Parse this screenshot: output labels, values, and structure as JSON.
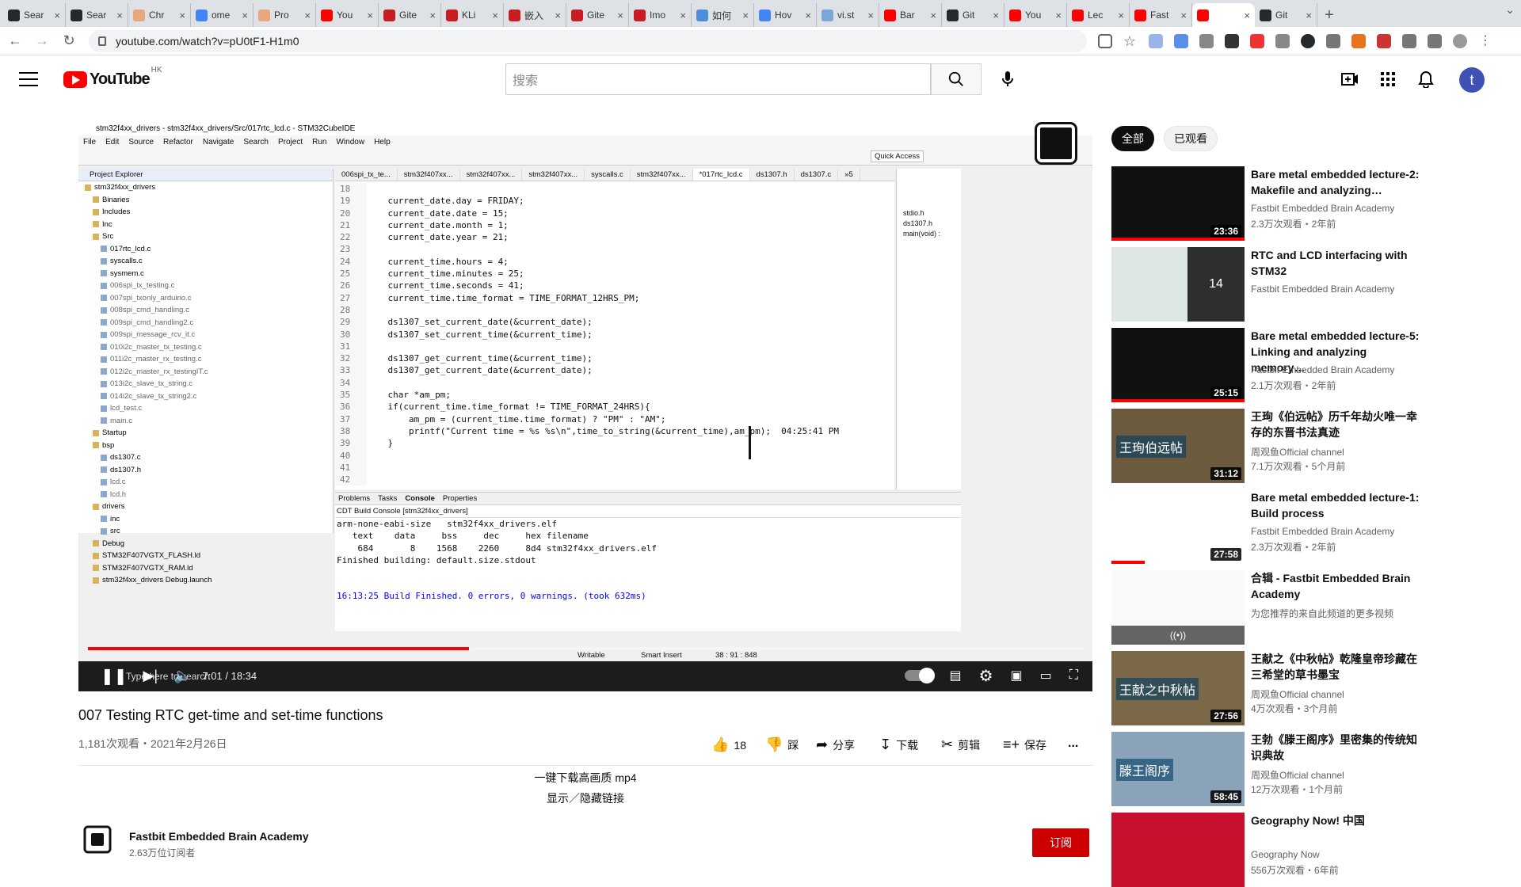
{
  "browser": {
    "tabs": [
      {
        "label": "Sear",
        "color": "#24292e"
      },
      {
        "label": "Sear",
        "color": "#24292e"
      },
      {
        "label": "Chr",
        "color": "#e8a87c"
      },
      {
        "label": "ome",
        "color": "#4285f4"
      },
      {
        "label": "Pro",
        "color": "#e8a87c"
      },
      {
        "label": "You",
        "color": "#ff0000"
      },
      {
        "label": "Gite",
        "color": "#c71d23"
      },
      {
        "label": "KLi",
        "color": "#c71d23"
      },
      {
        "label": "嵌入",
        "color": "#c71d23"
      },
      {
        "label": "Gite",
        "color": "#c71d23"
      },
      {
        "label": "Imo",
        "color": "#c71d23"
      },
      {
        "label": "如何",
        "color": "#4a90d9"
      },
      {
        "label": "Hov",
        "color": "#4285f4"
      },
      {
        "label": "vi.st",
        "color": "#7aa7d8"
      },
      {
        "label": "Bar",
        "color": "#ff0000"
      },
      {
        "label": "Git",
        "color": "#24292e"
      },
      {
        "label": "You",
        "color": "#ff0000"
      },
      {
        "label": "Lec",
        "color": "#ff0000"
      },
      {
        "label": "Fast",
        "color": "#ff0000"
      },
      {
        "label": "",
        "color": "#ff0000",
        "active": true
      },
      {
        "label": "Git",
        "color": "#24292e"
      }
    ],
    "new_tab": "+",
    "url": "youtube.com/watch?v=pU0tF1-H1m0"
  },
  "yt": {
    "logo_text": "YouTube",
    "region": "HK",
    "search_placeholder": "搜索",
    "avatar_letter": "t"
  },
  "video": {
    "ide_title": "stm32f4xx_drivers - stm32f4xx_drivers/Src/017rtc_lcd.c - STM32CubeIDE",
    "menu": [
      "File",
      "Edit",
      "Source",
      "Refactor",
      "Navigate",
      "Search",
      "Project",
      "Run",
      "Window",
      "Help"
    ],
    "quick_access": "Quick Access",
    "project_explorer": "Project Explorer",
    "tree": [
      {
        "t": "stm32f4xx_drivers",
        "i": 0
      },
      {
        "t": "Binaries",
        "i": 1
      },
      {
        "t": "Includes",
        "i": 1
      },
      {
        "t": "Inc",
        "i": 1
      },
      {
        "t": "Src",
        "i": 1
      },
      {
        "t": "017rtc_lcd.c",
        "i": 2
      },
      {
        "t": "syscalls.c",
        "i": 2
      },
      {
        "t": "sysmem.c",
        "i": 2
      },
      {
        "t": "006spi_tx_testing.c",
        "i": 2,
        "d": true
      },
      {
        "t": "007spi_txonly_arduino.c",
        "i": 2,
        "d": true
      },
      {
        "t": "008spi_cmd_handling.c",
        "i": 2,
        "d": true
      },
      {
        "t": "009spi_cmd_handling2.c",
        "i": 2,
        "d": true
      },
      {
        "t": "009spi_message_rcv_it.c",
        "i": 2,
        "d": true
      },
      {
        "t": "010i2c_master_tx_testing.c",
        "i": 2,
        "d": true
      },
      {
        "t": "011i2c_master_rx_testing.c",
        "i": 2,
        "d": true
      },
      {
        "t": "012i2c_master_rx_testingIT.c",
        "i": 2,
        "d": true
      },
      {
        "t": "013i2c_slave_tx_string.c",
        "i": 2,
        "d": true
      },
      {
        "t": "014i2c_slave_tx_string2.c",
        "i": 2,
        "d": true
      },
      {
        "t": "lcd_test.c",
        "i": 2,
        "d": true
      },
      {
        "t": "main.c",
        "i": 2,
        "d": true
      },
      {
        "t": "Startup",
        "i": 1
      },
      {
        "t": "bsp",
        "i": 1
      },
      {
        "t": "ds1307.c",
        "i": 2
      },
      {
        "t": "ds1307.h",
        "i": 2
      },
      {
        "t": "lcd.c",
        "i": 2,
        "d": true
      },
      {
        "t": "lcd.h",
        "i": 2,
        "d": true
      },
      {
        "t": "drivers",
        "i": 1
      },
      {
        "t": "inc",
        "i": 2
      },
      {
        "t": "src",
        "i": 2
      },
      {
        "t": "Debug",
        "i": 1
      },
      {
        "t": "STM32F407VGTX_FLASH.ld",
        "i": 1
      },
      {
        "t": "STM32F407VGTX_RAM.ld",
        "i": 1
      },
      {
        "t": "stm32f4xx_drivers Debug.launch",
        "i": 1
      }
    ],
    "editor_tabs": [
      "006spi_tx_te...",
      "stm32f407xx...",
      "stm32f407xx...",
      "stm32f407xx...",
      "syscalls.c",
      "stm32f407xx...",
      "*017rtc_lcd.c",
      "ds1307.h",
      "ds1307.c",
      "»5"
    ],
    "code": [
      "18|",
      "19|    current_date.day = FRIDAY;",
      "20|    current_date.date = 15;",
      "21|    current_date.month = 1;",
      "22|    current_date.year = 21;",
      "23|",
      "24|    current_time.hours = 4;",
      "25|    current_time.minutes = 25;",
      "26|    current_time.seconds = 41;",
      "27|    current_time.time_format = TIME_FORMAT_12HRS_PM;",
      "28|",
      "29|    ds1307_set_current_date(&current_date);",
      "30|    ds1307_set_current_time(&current_time);",
      "31|",
      "32|    ds1307_get_current_time(&current_time);",
      "33|    ds1307_get_current_date(&current_date);",
      "34|",
      "35|    char *am_pm;",
      "36|    if(current_time.time_format != TIME_FORMAT_24HRS){",
      "37|        am_pm = (current_time.time_format) ? \"PM\" : \"AM\";",
      "38|        printf(\"Current time = %s %s\\n\",time_to_string(&current_time),am_pm);  04:25:41 PM",
      "39|    }",
      "40|",
      "41|",
      "42|"
    ],
    "outline": [
      "stdio.h",
      "ds1307.h",
      "main(void) :"
    ],
    "console_tabs": [
      "Problems",
      "Tasks",
      "Console",
      "Properties"
    ],
    "console_title": "CDT Build Console [stm32f4xx_drivers]",
    "console_lines": [
      "arm-none-eabi-size   stm32f4xx_drivers.elf",
      "   text    data     bss     dec     hex filename",
      "    684       8    1568    2260     8d4 stm32f4xx_drivers.elf",
      "Finished building: default.size.stdout",
      "",
      "",
      "16:13:25 Build Finished. 0 errors, 0 warnings. (took 632ms)"
    ],
    "status": {
      "writable": "Writable",
      "insert": "Smart Insert",
      "pos": "38 : 91 : 848"
    },
    "taskbar_search": "Type here to search",
    "time": "7:01 / 18:34",
    "progress": 0.383
  },
  "watch": {
    "title": "007 Testing RTC get-time and set-time functions",
    "meta": "1,181次观看・2021年2月26日",
    "like_count": "18",
    "dislike": "踩",
    "share": "分享",
    "download": "下载",
    "clip": "剪辑",
    "save": "保存",
    "more": "...",
    "desc1": "一键下载高画质 mp4",
    "desc2": "显示／隐藏链接",
    "channel": "Fastbit Embedded Brain Academy",
    "subs": "2.63万位订阅者",
    "subscribe": "订阅"
  },
  "sidebar": {
    "chips": [
      "全部",
      "已观看"
    ],
    "items": [
      {
        "title": "Bare metal embedded lecture-2: Makefile and analyzing…",
        "channel": "Fastbit Embedded Brain Academy",
        "meta": "2.3万次观看・2年前",
        "dur": "23:36",
        "bg": "#111111",
        "progress": 1.0
      },
      {
        "title": "RTC and LCD interfacing with STM32",
        "channel": "Fastbit Embedded Brain Academy",
        "meta": "",
        "dur": "14",
        "bg": "#dfe6e6",
        "playlist": true
      },
      {
        "title": "Bare metal embedded lecture-5: Linking and analyzing memory…",
        "channel": "Fastbit Embedded Brain Academy",
        "meta": "2.1万次观看・2年前",
        "dur": "25:15",
        "bg": "#111111",
        "progress": 1.0
      },
      {
        "title": "王珣《伯远帖》历千年劫火唯一幸存的东晋书法真迹",
        "channel": "周观鱼Official channel",
        "meta": "7.1万次观看・5个月前",
        "dur": "31:12",
        "bg": "#6b5a3e",
        "overlay": "王珣伯远帖"
      },
      {
        "title": "Bare metal embedded lecture-1: Build process",
        "channel": "Fastbit Embedded Brain Academy",
        "meta": "2.3万次观看・2年前",
        "dur": "27:58",
        "bg": "#ffffff",
        "progress": 0.25
      },
      {
        "title": "合辑 - Fastbit Embedded Brain Academy",
        "channel": "为您推荐的来自此频道的更多视频",
        "meta": "",
        "dur": "",
        "bg": "#fafafa",
        "mix": true
      },
      {
        "title": "王献之《中秋帖》乾隆皇帝珍藏在三希堂的草书墨宝",
        "channel": "周观鱼Official channel",
        "meta": "4万次观看・3个月前",
        "dur": "27:56",
        "bg": "#7a6848",
        "overlay": "王献之中秋帖"
      },
      {
        "title": "王勃《滕王阁序》里密集的传统知识典故",
        "channel": "周观鱼Official channel",
        "meta": "12万次观看・1个月前",
        "dur": "58:45",
        "bg": "#8aa3b8",
        "overlay": "滕王阁序"
      },
      {
        "title": "Geography Now! 中国",
        "channel": "Geography Now",
        "meta": "556万次观看・6年前",
        "dur": "",
        "bg": "#c8102e"
      }
    ]
  }
}
